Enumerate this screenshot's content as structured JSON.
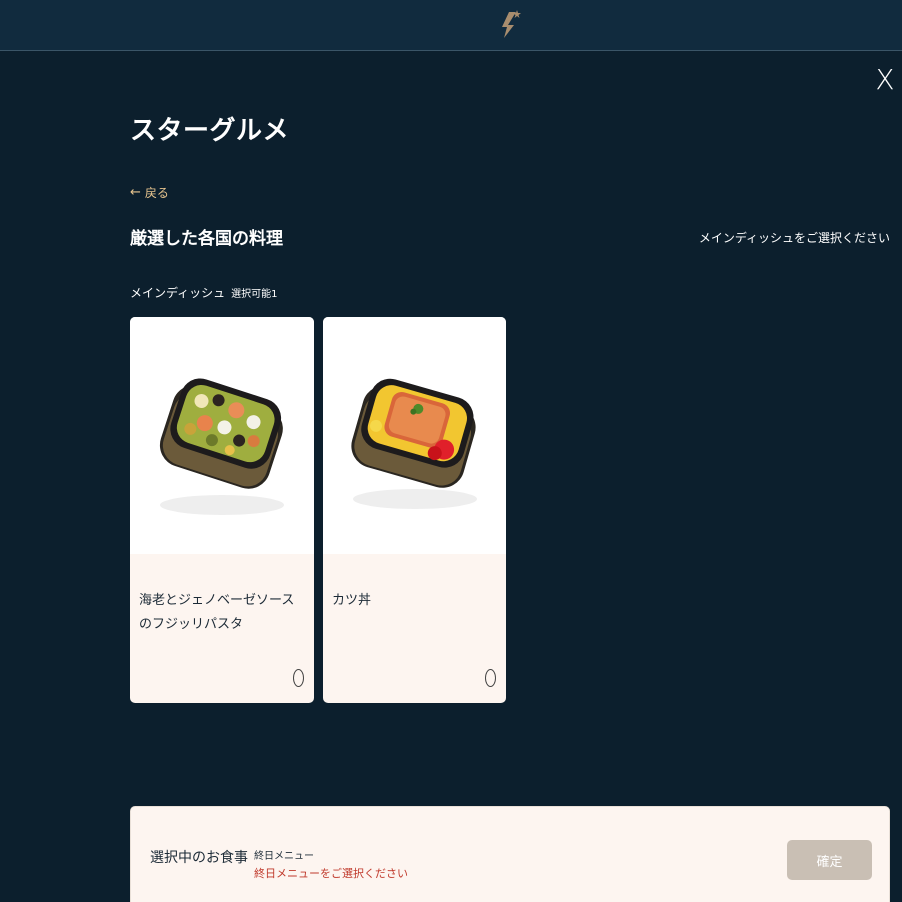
{
  "header": {
    "logo_icon": "star-lightning-logo",
    "close_label": "X"
  },
  "page": {
    "title": "スターグルメ",
    "back_label": "戻る",
    "section_title": "厳選した各国の料理",
    "select_prompt": "メインディッシュをご選択ください"
  },
  "category": {
    "name": "メインディッシュ",
    "limit": "選択可能1"
  },
  "items": [
    {
      "name": "海老とジェノベーゼソースのフジッリパスタ",
      "selected": false
    },
    {
      "name": "カツ丼",
      "selected": false
    }
  ],
  "footer": {
    "label": "選択中のお食事",
    "menu_type": "終日メニュー",
    "warning": "終日メニューをご選択ください",
    "confirm_label": "確定"
  },
  "colors": {
    "background": "#0c1f2d",
    "header": "#112b3e",
    "accent": "#e8c58f",
    "card": "#fdf5f0",
    "warning": "#c0392b",
    "button_disabled": "#c9bfb4"
  }
}
